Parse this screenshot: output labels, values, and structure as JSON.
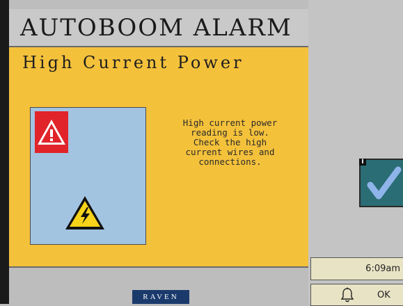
{
  "alarm": {
    "title": "AUTOBOOM ALARM",
    "subtitle": "High Current Power",
    "message": "High current power\nreading is low.\nCheck the high\ncurrent wires and\nconnections."
  },
  "icons": {
    "warning": "warning-triangle-icon",
    "electrical_hazard": "electrical-hazard-icon",
    "accept": "checkmark-icon",
    "bell": "bell-icon"
  },
  "status": {
    "time": "6:09am",
    "badge": "I"
  },
  "buttons": {
    "ok_label": "OK"
  },
  "branding": {
    "logo_text": "RAVEN"
  },
  "colors": {
    "panel": "#f4c13b",
    "image_box": "#a3c4e1",
    "warning_red": "#e0242a",
    "accept_button": "#2b6d74",
    "logo": "#1b3a6c"
  }
}
